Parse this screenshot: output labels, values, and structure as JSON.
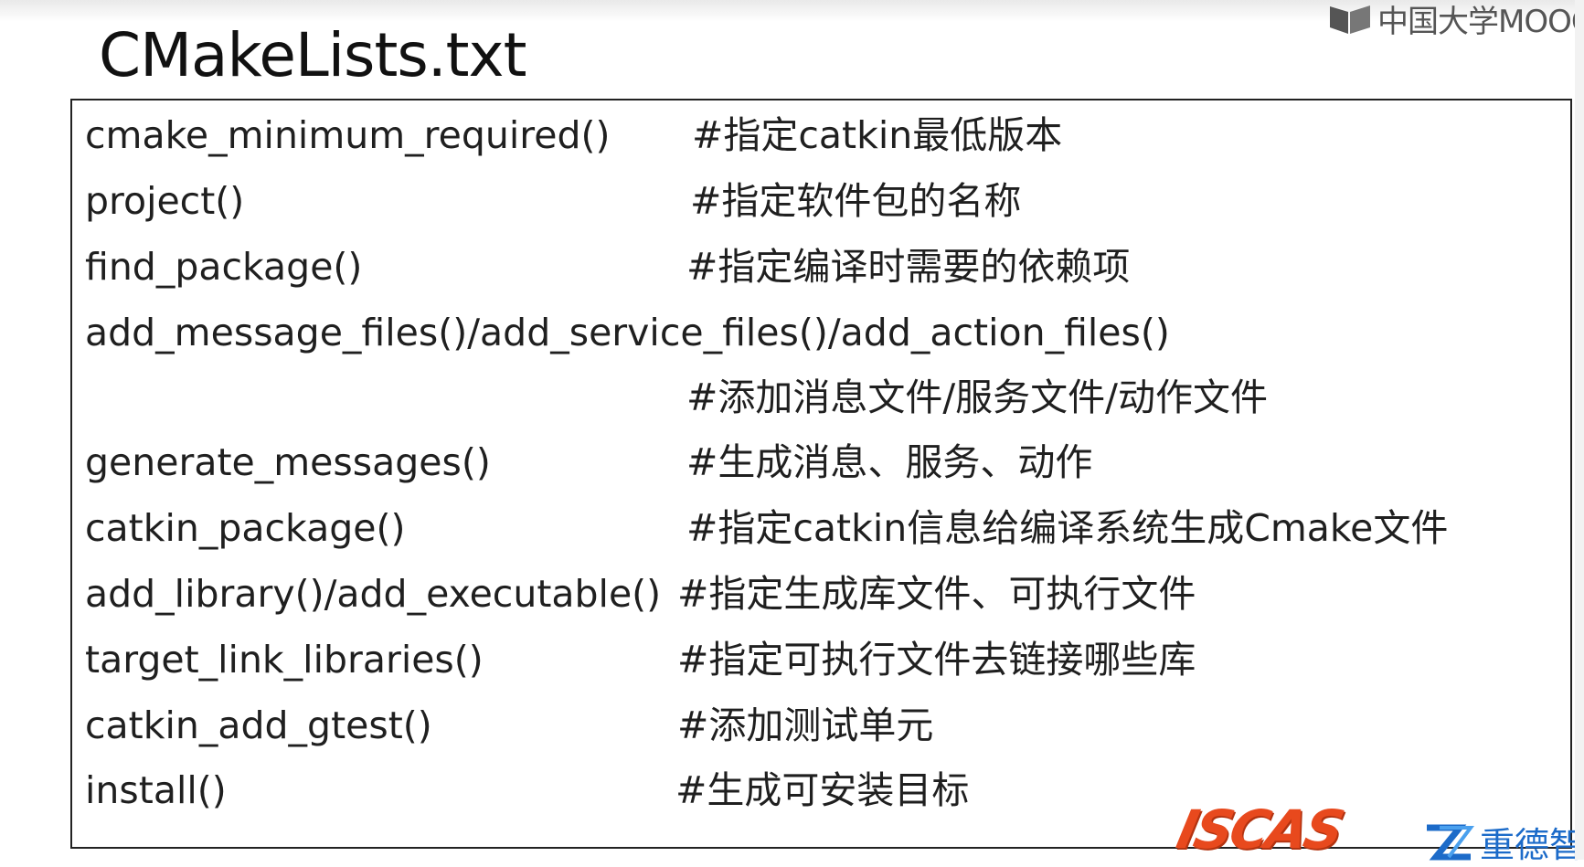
{
  "watermark": {
    "text": "中国大学MOOC"
  },
  "slide": {
    "title": "CMakeLists.txt",
    "rows": [
      {
        "code": "cmake_minimum_required()",
        "comment": "#指定catkin最低版本"
      },
      {
        "code": "project()",
        "comment": "#指定软件包的名称"
      },
      {
        "code": "find_package()",
        "comment": "#指定编译时需要的依赖项"
      },
      {
        "code": "add_message_files()/add_service_files()/add_action_files()",
        "comment": ""
      },
      {
        "code": "",
        "comment": "#添加消息文件/服务文件/动作文件"
      },
      {
        "code": "generate_messages()",
        "comment": "#生成消息、服务、动作"
      },
      {
        "code": "catkin_package()",
        "comment": "#指定catkin信息给编译系统生成Cmake文件"
      },
      {
        "code": "add_library()/add_executable()",
        "comment": "#指定生成库文件、可执行文件"
      },
      {
        "code": "target_link_libraries()",
        "comment": "#指定可执行文件去链接哪些库"
      },
      {
        "code": "catkin_add_gtest()",
        "comment": "#添加测试单元"
      },
      {
        "code": "install()",
        "comment": "#生成可安装目标"
      }
    ]
  },
  "logos": {
    "iscas": "ISCAS",
    "zd": "重德智"
  }
}
